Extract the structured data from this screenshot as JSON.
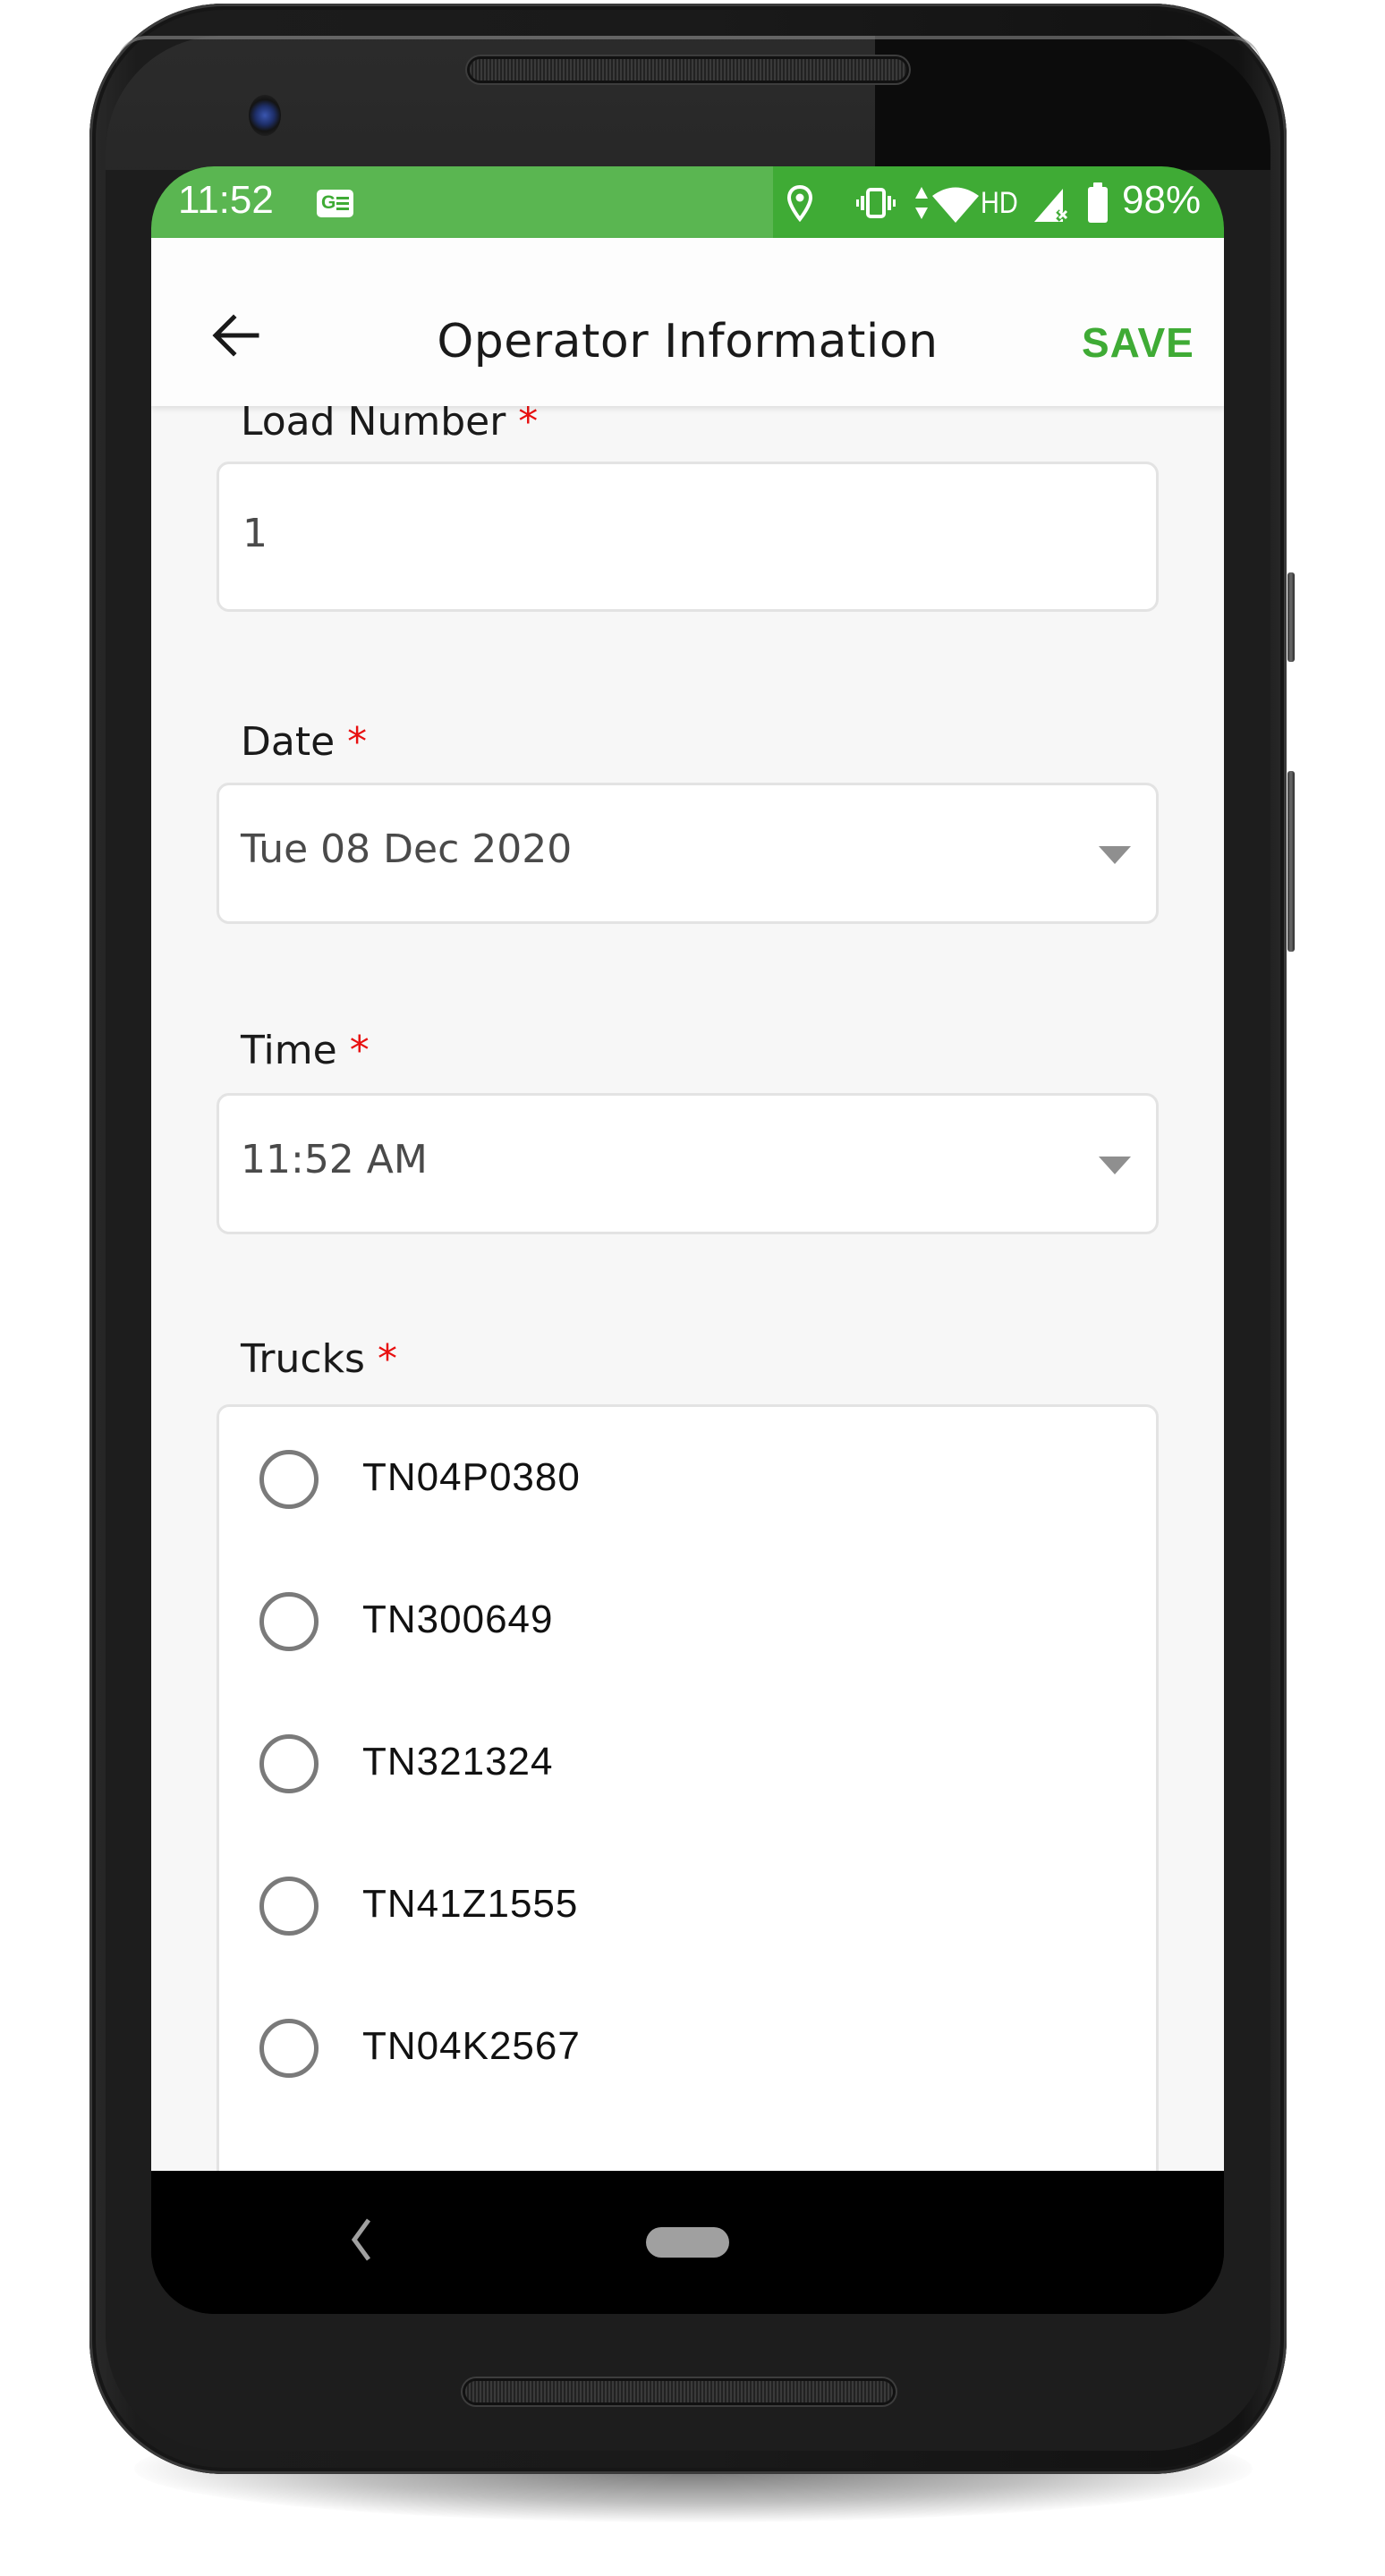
{
  "status_bar": {
    "time": "11:52",
    "notification_icons": [
      "google-news-icon"
    ],
    "system_icons": [
      "location-icon",
      "vibrate-icon",
      "data-activity-icon",
      "wifi-icon",
      "hd-voice-icon",
      "cell-signal-icon",
      "battery-icon"
    ],
    "hd_label": "HD",
    "battery_percent": "98%"
  },
  "header": {
    "title": "Operator Information",
    "back_icon": "arrow-left-icon",
    "save_label": "SAVE"
  },
  "form": {
    "required_marker": "*",
    "load_number": {
      "label": "Load Number",
      "value": "1"
    },
    "date": {
      "label": "Date",
      "value": "Tue 08 Dec 2020"
    },
    "time": {
      "label": "Time",
      "value": "11:52 AM"
    },
    "trucks": {
      "label": "Trucks",
      "options": [
        {
          "label": "TN04P0380",
          "selected": false
        },
        {
          "label": "TN300649",
          "selected": false
        },
        {
          "label": "TN321324",
          "selected": false
        },
        {
          "label": "TN41Z1555",
          "selected": false
        },
        {
          "label": "TN04K2567",
          "selected": false
        }
      ]
    }
  },
  "nav_bar": {
    "back_icon": "nav-back-icon",
    "home_icon": "nav-home-pill"
  },
  "colors": {
    "accent": "#3fab35",
    "required": "#e81010",
    "background": "#f7f7f7"
  }
}
